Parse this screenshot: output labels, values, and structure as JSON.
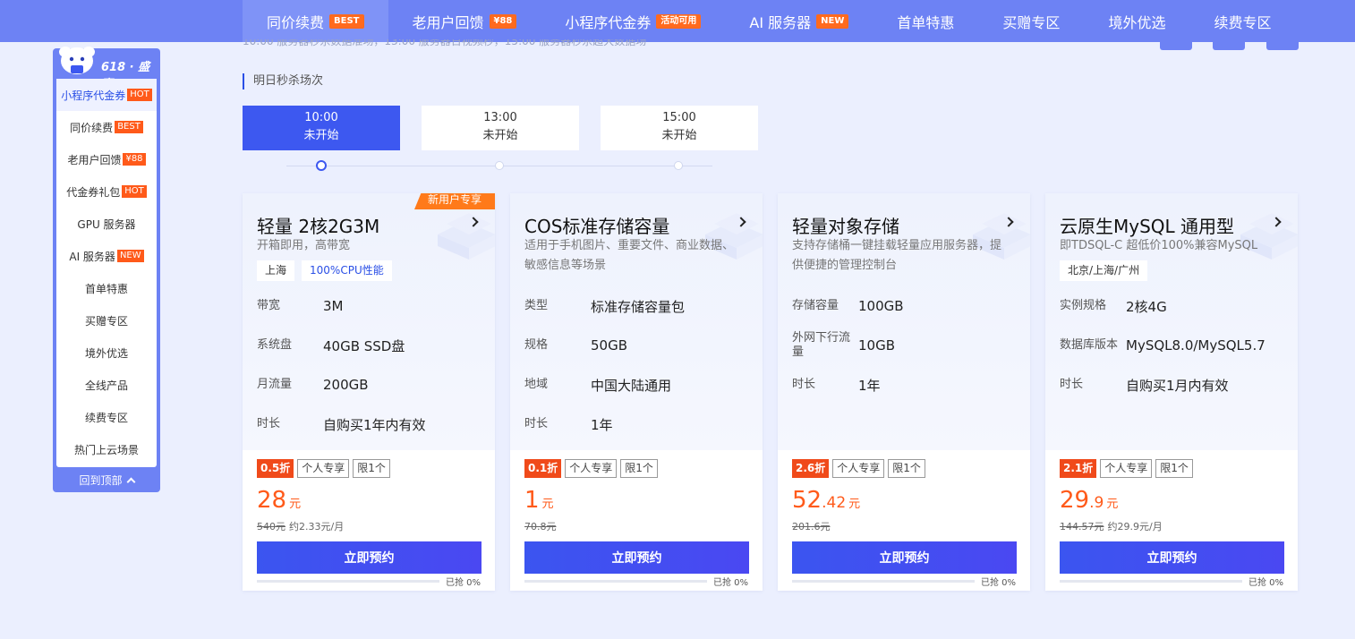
{
  "topnav": [
    {
      "label": "同价续费",
      "badge": "BEST",
      "active": true
    },
    {
      "label": "老用户回馈",
      "badge": "¥88",
      "active": false
    },
    {
      "label": "小程序代金券",
      "badge": "活动可用",
      "active": false
    },
    {
      "label": "AI 服务器",
      "badge": "NEW",
      "active": false
    },
    {
      "label": "首单特惠",
      "badge": "",
      "active": false
    },
    {
      "label": "买赠专区",
      "badge": "",
      "active": false
    },
    {
      "label": "境外优选",
      "badge": "",
      "active": false
    },
    {
      "label": "续费专区",
      "badge": "",
      "active": false
    }
  ],
  "hidden_line": "10:00 服务器秒杀数据准场，13:00 服务器日视频秒，15:00 服务器秒杀超大数据场",
  "sidebar": {
    "title": "618 · 盛惠",
    "items": [
      {
        "label": "小程序代金券",
        "badge": "HOT",
        "active": true
      },
      {
        "label": "同价续费",
        "badge": "BEST",
        "active": false
      },
      {
        "label": "老用户回馈",
        "badge": "¥88",
        "active": false
      },
      {
        "label": "代金券礼包",
        "badge": "HOT",
        "active": false
      },
      {
        "label": "GPU 服务器",
        "badge": "",
        "active": false
      },
      {
        "label": "AI 服务器",
        "badge": "NEW",
        "active": false
      },
      {
        "label": "首单特惠",
        "badge": "",
        "active": false
      },
      {
        "label": "买赠专区",
        "badge": "",
        "active": false
      },
      {
        "label": "境外优选",
        "badge": "",
        "active": false
      },
      {
        "label": "全线产品",
        "badge": "",
        "active": false
      },
      {
        "label": "续费专区",
        "badge": "",
        "active": false
      },
      {
        "label": "热门上云场景",
        "badge": "",
        "active": false
      }
    ],
    "back_to_top": "回到顶部"
  },
  "session": {
    "label": "明日秒杀场次",
    "slots": [
      {
        "time": "10:00",
        "status": "未开始",
        "active": true
      },
      {
        "time": "13:00",
        "status": "未开始",
        "active": false
      },
      {
        "time": "15:00",
        "status": "未开始",
        "active": false
      }
    ]
  },
  "cards": [
    {
      "ribbon": "新用户专享",
      "title": "轻量 2核2G3M",
      "subtitle": "开箱即用，高带宽",
      "tags": [
        "上海",
        "100%CPU性能"
      ],
      "specs": [
        {
          "key": "带宽",
          "value": "3M"
        },
        {
          "key": "系统盘",
          "value": "40GB SSD盘"
        },
        {
          "key": "月流量",
          "value": "200GB"
        },
        {
          "key": "时长",
          "value": "自购买1年内有效"
        }
      ],
      "discount": "0.5折",
      "labels": [
        "个人专享",
        "限1个"
      ],
      "price_int": "28",
      "price_dec": "",
      "unit": "元",
      "original": "540元",
      "monthly": "约2.33元/月",
      "button": "立即预约",
      "progress": 0,
      "progress_text": "已抢 0%"
    },
    {
      "ribbon": "",
      "title": "COS标准存储容量",
      "subtitle": "适用于手机图片、重要文件、商业数据、敏感信息等场景",
      "tags": [],
      "specs": [
        {
          "key": "类型",
          "value": "标准存储容量包"
        },
        {
          "key": "规格",
          "value": "50GB"
        },
        {
          "key": "地域",
          "value": "中国大陆通用"
        },
        {
          "key": "时长",
          "value": "1年"
        }
      ],
      "discount": "0.1折",
      "labels": [
        "个人专享",
        "限1个"
      ],
      "price_int": "1",
      "price_dec": "",
      "unit": "元",
      "original": "70.8元",
      "monthly": "",
      "button": "立即预约",
      "progress": 0,
      "progress_text": "已抢 0%"
    },
    {
      "ribbon": "",
      "title": "轻量对象存储",
      "subtitle": "支持存储桶一键挂载轻量应用服务器，提供便捷的管理控制台",
      "tags": [],
      "specs": [
        {
          "key": "存储容量",
          "value": "100GB"
        },
        {
          "key": "外网下行流量",
          "value": "10GB"
        },
        {
          "key": "时长",
          "value": "1年"
        }
      ],
      "discount": "2.6折",
      "labels": [
        "个人专享",
        "限1个"
      ],
      "price_int": "52",
      "price_dec": ".42",
      "unit": "元",
      "original": "201.6元",
      "monthly": "",
      "button": "立即预约",
      "progress": 0,
      "progress_text": "已抢 0%"
    },
    {
      "ribbon": "",
      "title": "云原生MySQL 通用型",
      "subtitle": "即TDSQL-C 超低价100%兼容MySQL",
      "tags": [
        "北京/上海/广州"
      ],
      "specs": [
        {
          "key": "实例规格",
          "value": "2核4G"
        },
        {
          "key": "数据库版本",
          "value": "MySQL8.0/MySQL5.7"
        },
        {
          "key": "时长",
          "value": "自购买1月内有效"
        }
      ],
      "discount": "2.1折",
      "labels": [
        "个人专享",
        "限1个"
      ],
      "price_int": "29",
      "price_dec": ".9",
      "unit": "元",
      "original": "144.57元",
      "monthly": "约29.9元/月",
      "button": "立即预约",
      "progress": 0,
      "progress_text": "已抢 0%"
    }
  ]
}
